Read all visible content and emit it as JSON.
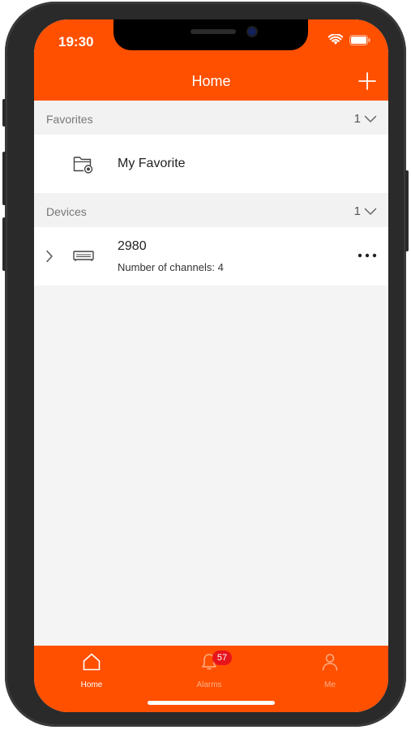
{
  "status_bar": {
    "time": "19:30",
    "icons": [
      "wifi-icon",
      "battery-icon"
    ]
  },
  "header": {
    "title": "Home",
    "add_icon": "plus-icon"
  },
  "favorites": {
    "label": "Favorites",
    "count": "1",
    "items": [
      {
        "name": "My Favorite",
        "icon": "favorite-folder-icon"
      }
    ]
  },
  "devices": {
    "label": "Devices",
    "count": "1",
    "items": [
      {
        "name": "2980",
        "subtitle": "Number of channels: 4",
        "icon": "dvr-device-icon"
      }
    ]
  },
  "tabbar": {
    "tabs": [
      {
        "label": "Home",
        "icon": "home-icon",
        "active": true
      },
      {
        "label": "Alarms",
        "icon": "bell-icon",
        "active": false,
        "badge": "57"
      },
      {
        "label": "Me",
        "icon": "person-icon",
        "active": false
      }
    ]
  },
  "colors": {
    "brand": "#ff5000",
    "badge": "#e8141c",
    "background": "#f4f4f4"
  }
}
